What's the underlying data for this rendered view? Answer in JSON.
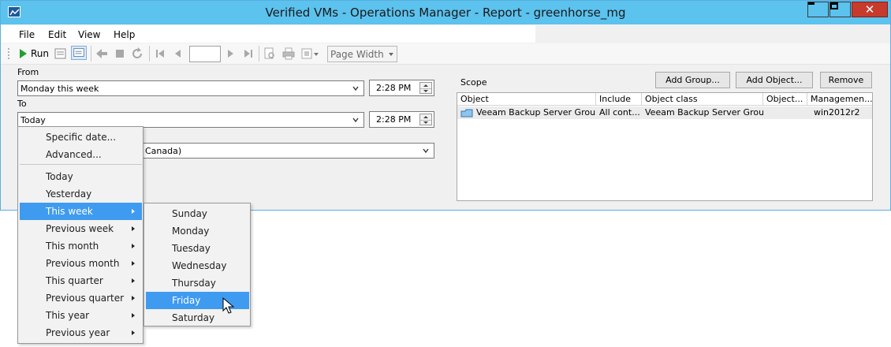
{
  "window": {
    "title": "Verified VMs - Operations Manager - Report - greenhorse_mg",
    "close_glyph": "✕"
  },
  "menubar": {
    "items": [
      "File",
      "Edit",
      "View",
      "Help"
    ]
  },
  "toolbar": {
    "run_label": "Run",
    "page_number": "",
    "zoom": "Page Width"
  },
  "params": {
    "from_label": "From",
    "from_value": "Monday this week",
    "from_time": "2:28 PM",
    "to_label": "To",
    "to_value": "Today",
    "to_time": "2:28 PM",
    "timezone_fragment": "Canada)"
  },
  "scope": {
    "label": "Scope",
    "buttons": {
      "add_group": "Add Group...",
      "add_object": "Add Object...",
      "remove": "Remove"
    },
    "columns": [
      "Object",
      "Include",
      "Object class",
      "Object...",
      "Managemen..."
    ],
    "rows": [
      {
        "object": "Veeam Backup Server Group",
        "include": "All cont...",
        "object_class": "Veeam Backup Server Group",
        "object_extra": "",
        "management": "win2012r2"
      }
    ]
  },
  "date_menu": {
    "items": [
      "Specific date...",
      "Advanced...",
      "Today",
      "Yesterday",
      "This week",
      "Previous week",
      "This month",
      "Previous month",
      "This quarter",
      "Previous quarter",
      "This year",
      "Previous year"
    ],
    "selected": "This week"
  },
  "week_submenu": {
    "items": [
      "Sunday",
      "Monday",
      "Tuesday",
      "Wednesday",
      "Thursday",
      "Friday",
      "Saturday"
    ],
    "selected": "Friday"
  },
  "icons": {
    "app": "report-app-icon",
    "run": "run-play-icon",
    "cursor": "mouse-pointer-icon"
  },
  "colors": {
    "titlebar": "#5cc2ee",
    "close_button": "#c73b2c",
    "menu_highlight": "#3f9bf0",
    "run_green": "#22a030"
  }
}
